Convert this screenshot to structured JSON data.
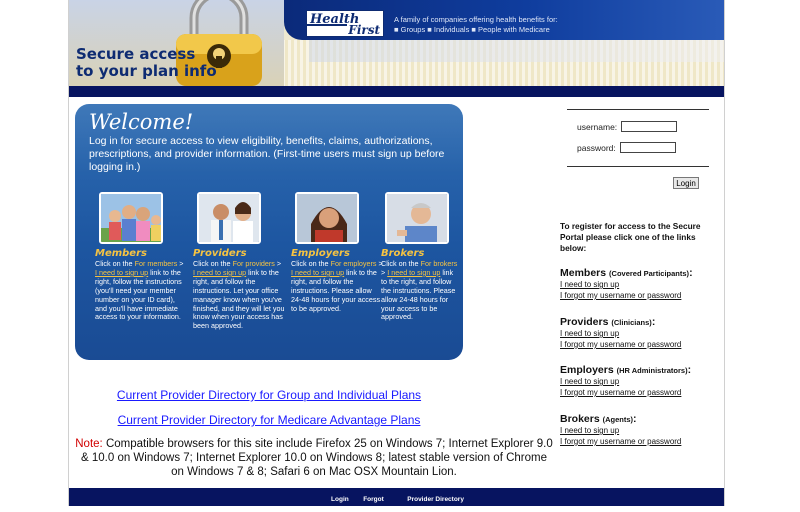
{
  "header": {
    "title_line1": "Secure access",
    "title_line2": "to your plan info",
    "logo_line1": "Health",
    "logo_line2": "First",
    "tagline_line1": "A family of companies offering health benefits for:",
    "tagline_line2": "■ Groups ■ Individuals ■ People with Medicare"
  },
  "welcome": {
    "title": "Welcome!",
    "intro": "Log in for secure access to view eligibility, benefits, claims, authorizations, prescriptions, and provider information. (First-time users must sign up before logging in.)",
    "columns": [
      {
        "title": "Members",
        "pre": "Click on the",
        "hl": "For members",
        "sep": " > ",
        "link": "I need to sign up",
        "post": "link to the right, follow the instructions (you'll need your member number on your ID card), and you'll have immediate access to your information."
      },
      {
        "title": "Providers",
        "pre": "Click on the",
        "hl": "For providers",
        "sep": " > ",
        "link": "I need to sign up",
        "post": "link to the right, and follow the instructions. Let your office manager know when you've finished, and they will let you know when your access has been approved."
      },
      {
        "title": "Employers",
        "pre": "Click on the",
        "hl": "For employers",
        "sep": " > ",
        "link": "I need to sign up",
        "post": "link to the right, and follow the instructions. Please allow 24-48 hours for your access to be approved."
      },
      {
        "title": "Brokers",
        "pre": "Click on the",
        "hl": "For brokers",
        "sep": " > ",
        "link": "I need to sign up",
        "post": "link to the right, and follow the instructions. Please allow 24-48 hours for your access to be approved."
      }
    ]
  },
  "links": {
    "directory_group": "Current Provider Directory for Group and Individual Plans",
    "directory_medicare": "Current Provider Directory for Medicare Advantage Plans"
  },
  "note": {
    "label": "Note:",
    "text": "Compatible browsers for this site include Firefox 25 on Windows 7; Internet Explorer 9.0 & 10.0 on Windows 7; Internet Explorer 10.0 on Windows 8; latest stable version of Chrome on Windows 7 & 8; Safari 6 on Mac OSX Mountain Lion."
  },
  "login": {
    "username_label": "username:",
    "password_label": "password:",
    "username_value": "",
    "password_value": "",
    "button": "Login"
  },
  "register": {
    "intro": "To register for access to the Secure Portal please click one of the links below:",
    "sections": [
      {
        "title": "Members",
        "sub": "(Covered Participants)",
        "colon": ":",
        "signup": "I need to sign up",
        "forgot": "I forgot my username or password"
      },
      {
        "title": "Providers",
        "sub": "(Clinicians)",
        "colon": ":",
        "signup": "I need to sign up",
        "forgot": "I forgot my username or password"
      },
      {
        "title": "Employers",
        "sub": "(HR Administrators)",
        "colon": ":",
        "signup": "I need to sign up",
        "forgot": "I forgot my username or password"
      },
      {
        "title": "Brokers",
        "sub": "(Agents)",
        "colon": ":",
        "signup": "I need to sign up",
        "forgot": "I forgot my username or password"
      }
    ]
  },
  "footer": {
    "login": "Login",
    "forgot": "Forgot",
    "directory": "Provider Directory"
  },
  "colors": {
    "navy": "#071460",
    "panel_blue": "#1d56a1",
    "gold": "#f5c342",
    "link_blue": "#1a1aff",
    "note_red": "#d10000"
  }
}
